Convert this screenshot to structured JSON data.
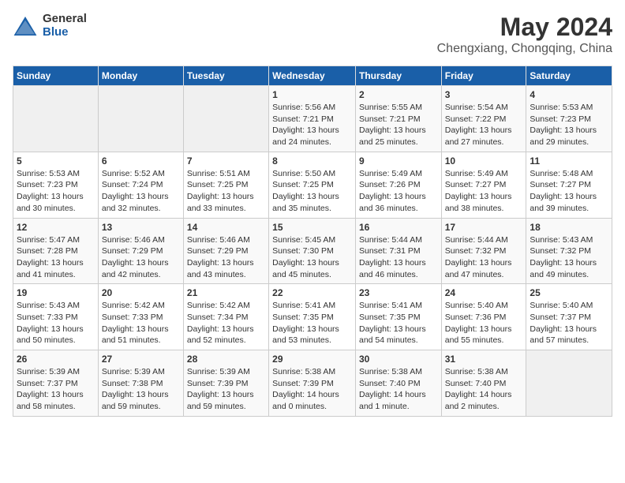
{
  "header": {
    "logo_general": "General",
    "logo_blue": "Blue",
    "title": "May 2024",
    "subtitle": "Chengxiang, Chongqing, China"
  },
  "weekdays": [
    "Sunday",
    "Monday",
    "Tuesday",
    "Wednesday",
    "Thursday",
    "Friday",
    "Saturday"
  ],
  "weeks": [
    [
      {
        "num": "",
        "info": ""
      },
      {
        "num": "",
        "info": ""
      },
      {
        "num": "",
        "info": ""
      },
      {
        "num": "1",
        "info": "Sunrise: 5:56 AM\nSunset: 7:21 PM\nDaylight: 13 hours and 24 minutes."
      },
      {
        "num": "2",
        "info": "Sunrise: 5:55 AM\nSunset: 7:21 PM\nDaylight: 13 hours and 25 minutes."
      },
      {
        "num": "3",
        "info": "Sunrise: 5:54 AM\nSunset: 7:22 PM\nDaylight: 13 hours and 27 minutes."
      },
      {
        "num": "4",
        "info": "Sunrise: 5:53 AM\nSunset: 7:23 PM\nDaylight: 13 hours and 29 minutes."
      }
    ],
    [
      {
        "num": "5",
        "info": "Sunrise: 5:53 AM\nSunset: 7:23 PM\nDaylight: 13 hours and 30 minutes."
      },
      {
        "num": "6",
        "info": "Sunrise: 5:52 AM\nSunset: 7:24 PM\nDaylight: 13 hours and 32 minutes."
      },
      {
        "num": "7",
        "info": "Sunrise: 5:51 AM\nSunset: 7:25 PM\nDaylight: 13 hours and 33 minutes."
      },
      {
        "num": "8",
        "info": "Sunrise: 5:50 AM\nSunset: 7:25 PM\nDaylight: 13 hours and 35 minutes."
      },
      {
        "num": "9",
        "info": "Sunrise: 5:49 AM\nSunset: 7:26 PM\nDaylight: 13 hours and 36 minutes."
      },
      {
        "num": "10",
        "info": "Sunrise: 5:49 AM\nSunset: 7:27 PM\nDaylight: 13 hours and 38 minutes."
      },
      {
        "num": "11",
        "info": "Sunrise: 5:48 AM\nSunset: 7:27 PM\nDaylight: 13 hours and 39 minutes."
      }
    ],
    [
      {
        "num": "12",
        "info": "Sunrise: 5:47 AM\nSunset: 7:28 PM\nDaylight: 13 hours and 41 minutes."
      },
      {
        "num": "13",
        "info": "Sunrise: 5:46 AM\nSunset: 7:29 PM\nDaylight: 13 hours and 42 minutes."
      },
      {
        "num": "14",
        "info": "Sunrise: 5:46 AM\nSunset: 7:29 PM\nDaylight: 13 hours and 43 minutes."
      },
      {
        "num": "15",
        "info": "Sunrise: 5:45 AM\nSunset: 7:30 PM\nDaylight: 13 hours and 45 minutes."
      },
      {
        "num": "16",
        "info": "Sunrise: 5:44 AM\nSunset: 7:31 PM\nDaylight: 13 hours and 46 minutes."
      },
      {
        "num": "17",
        "info": "Sunrise: 5:44 AM\nSunset: 7:32 PM\nDaylight: 13 hours and 47 minutes."
      },
      {
        "num": "18",
        "info": "Sunrise: 5:43 AM\nSunset: 7:32 PM\nDaylight: 13 hours and 49 minutes."
      }
    ],
    [
      {
        "num": "19",
        "info": "Sunrise: 5:43 AM\nSunset: 7:33 PM\nDaylight: 13 hours and 50 minutes."
      },
      {
        "num": "20",
        "info": "Sunrise: 5:42 AM\nSunset: 7:33 PM\nDaylight: 13 hours and 51 minutes."
      },
      {
        "num": "21",
        "info": "Sunrise: 5:42 AM\nSunset: 7:34 PM\nDaylight: 13 hours and 52 minutes."
      },
      {
        "num": "22",
        "info": "Sunrise: 5:41 AM\nSunset: 7:35 PM\nDaylight: 13 hours and 53 minutes."
      },
      {
        "num": "23",
        "info": "Sunrise: 5:41 AM\nSunset: 7:35 PM\nDaylight: 13 hours and 54 minutes."
      },
      {
        "num": "24",
        "info": "Sunrise: 5:40 AM\nSunset: 7:36 PM\nDaylight: 13 hours and 55 minutes."
      },
      {
        "num": "25",
        "info": "Sunrise: 5:40 AM\nSunset: 7:37 PM\nDaylight: 13 hours and 57 minutes."
      }
    ],
    [
      {
        "num": "26",
        "info": "Sunrise: 5:39 AM\nSunset: 7:37 PM\nDaylight: 13 hours and 58 minutes."
      },
      {
        "num": "27",
        "info": "Sunrise: 5:39 AM\nSunset: 7:38 PM\nDaylight: 13 hours and 59 minutes."
      },
      {
        "num": "28",
        "info": "Sunrise: 5:39 AM\nSunset: 7:39 PM\nDaylight: 13 hours and 59 minutes."
      },
      {
        "num": "29",
        "info": "Sunrise: 5:38 AM\nSunset: 7:39 PM\nDaylight: 14 hours and 0 minutes."
      },
      {
        "num": "30",
        "info": "Sunrise: 5:38 AM\nSunset: 7:40 PM\nDaylight: 14 hours and 1 minute."
      },
      {
        "num": "31",
        "info": "Sunrise: 5:38 AM\nSunset: 7:40 PM\nDaylight: 14 hours and 2 minutes."
      },
      {
        "num": "",
        "info": ""
      }
    ]
  ]
}
